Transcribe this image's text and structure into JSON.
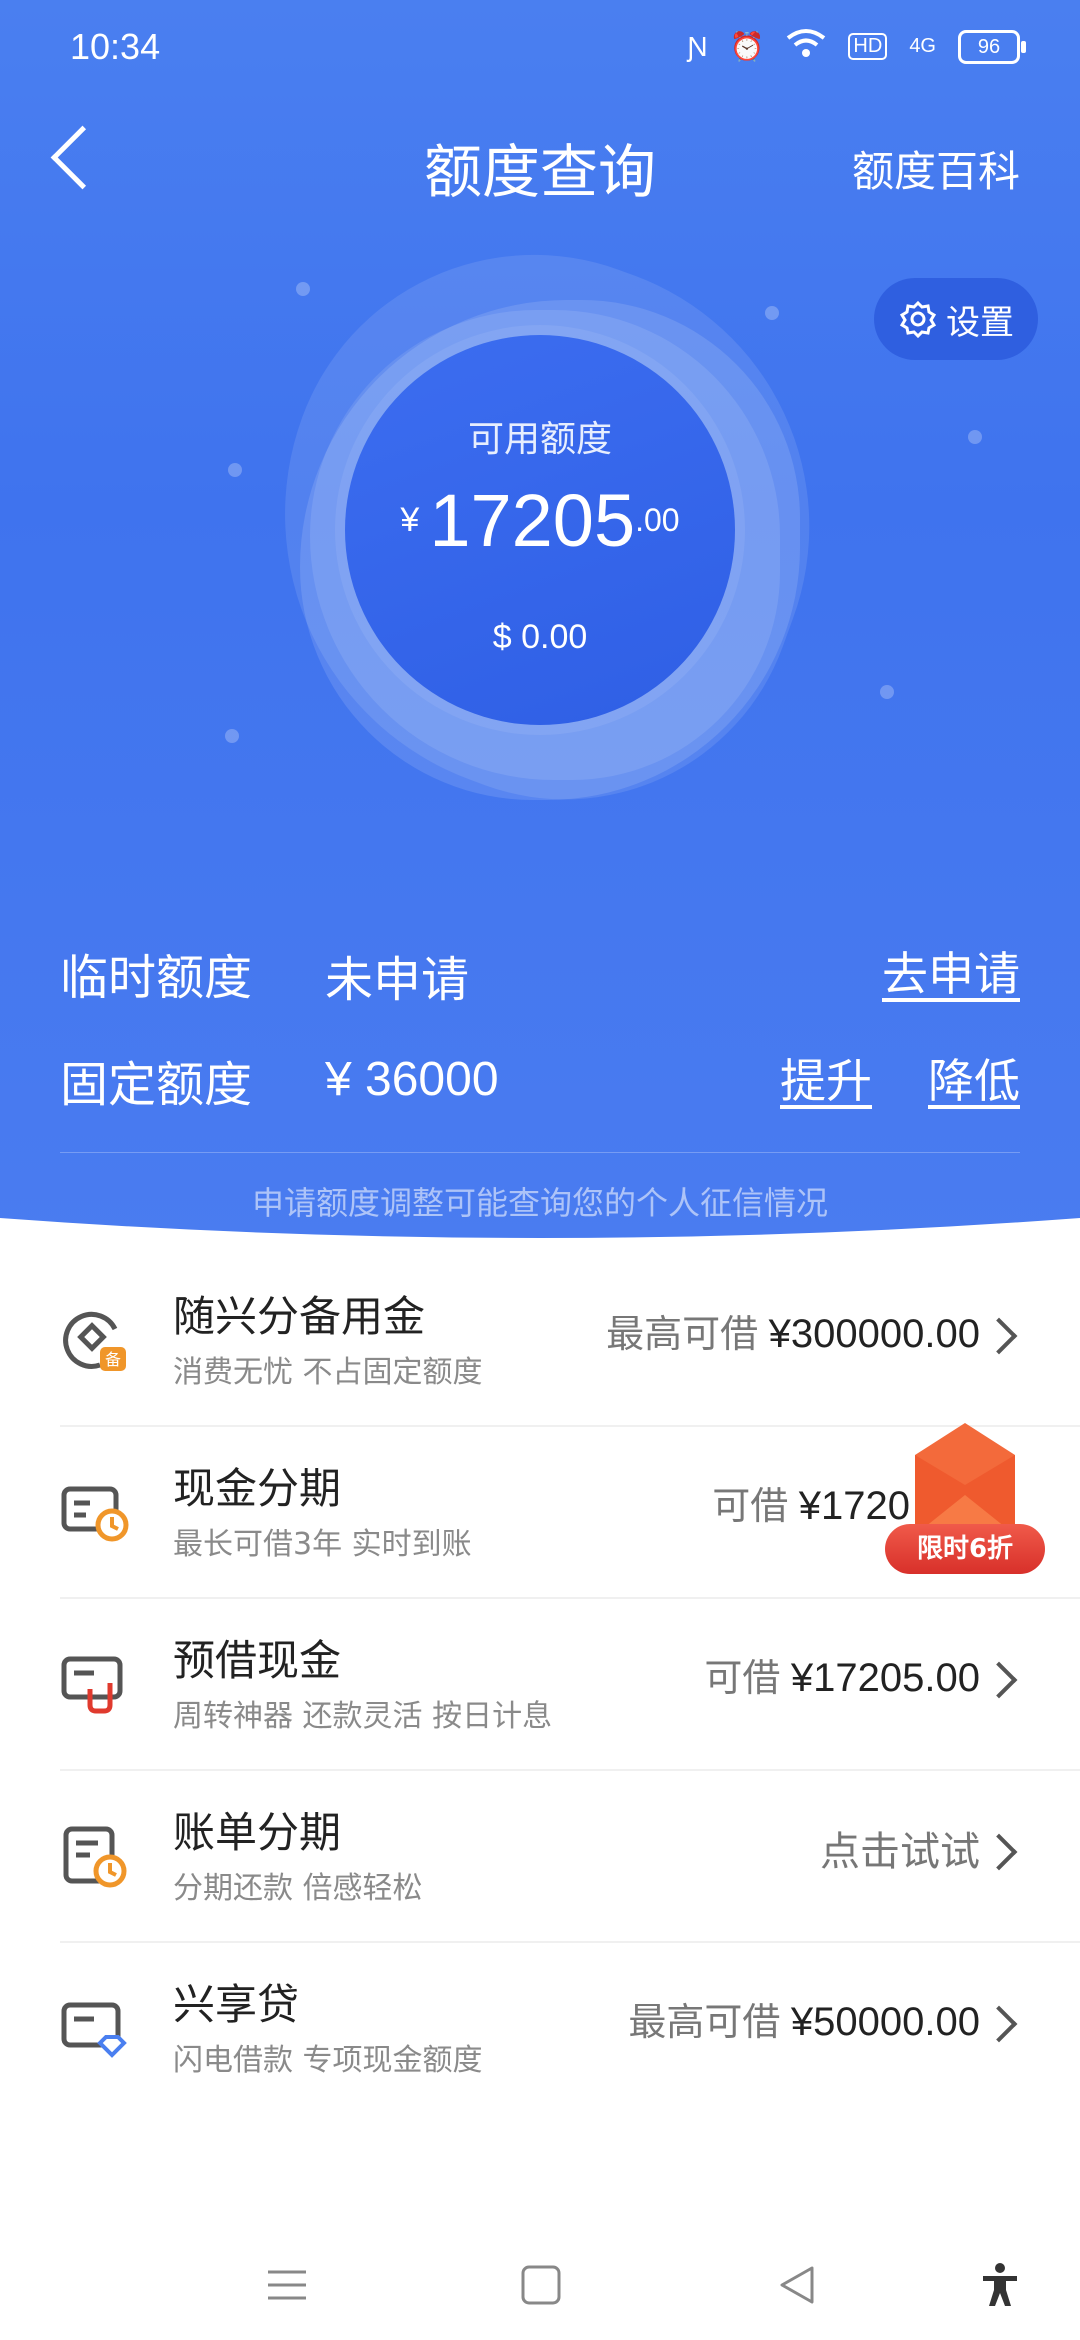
{
  "status_bar": {
    "time": "10:34",
    "network": "4G",
    "battery": "96"
  },
  "header": {
    "title": "额度查询",
    "right_link": "额度百科"
  },
  "settings_label": "设置",
  "available": {
    "label": "可用额度",
    "currency": "¥",
    "integer": "17205",
    "decimal": ".00",
    "usd": "$ 0.00"
  },
  "temporary": {
    "label": "临时额度",
    "value": "未申请",
    "action": "去申请"
  },
  "fixed": {
    "label": "固定额度",
    "value": "¥ 36000",
    "raise": "提升",
    "lower": "降低"
  },
  "note": "申请额度调整可能查询您的个人征信情况",
  "items": [
    {
      "name": "随兴分备用金",
      "desc": "消费无忧 不占固定额度",
      "prefix": "最高可借 ",
      "amount": "¥300000.00",
      "icon": "reserve-fund-icon"
    },
    {
      "name": "现金分期",
      "desc": "最长可借3年 实时到账",
      "prefix": "可借 ",
      "amount": "¥1720",
      "icon": "cash-installment-icon"
    },
    {
      "name": "预借现金",
      "desc": "周转神器 还款灵活 按日计息",
      "prefix": "可借 ",
      "amount": "¥17205.00",
      "icon": "cash-advance-icon"
    },
    {
      "name": "账单分期",
      "desc": "分期还款 倍感轻松",
      "prefix": "",
      "amount": "点击试试",
      "icon": "bill-installment-icon"
    },
    {
      "name": "兴享贷",
      "desc": "闪电借款 专项现金额度",
      "prefix": "最高可借 ",
      "amount": "¥50000.00",
      "icon": "loan-card-icon"
    }
  ],
  "promo": {
    "label": "限时6折"
  },
  "colors": {
    "hero_blue": "#4a7ff0",
    "button_blue": "#2f5fe0",
    "promo_red": "#d8302a",
    "accent_orange": "#f0962a"
  }
}
